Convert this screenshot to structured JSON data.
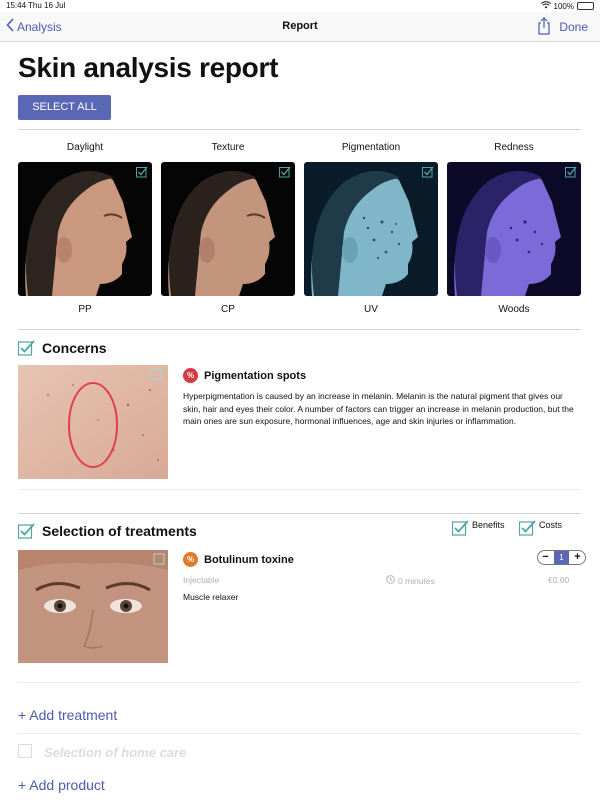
{
  "status_bar": {
    "time": "15:44",
    "date": "Thu 16 Jul",
    "battery": "100%"
  },
  "nav": {
    "back_label": "Analysis",
    "title": "Report",
    "done_label": "Done"
  },
  "page": {
    "title": "Skin analysis report",
    "select_all_label": "SELECT ALL"
  },
  "images": {
    "top_labels": [
      "Daylight",
      "Texture",
      "Pigmentation",
      "Redness"
    ],
    "bottom_labels": [
      "PP",
      "CP",
      "UV",
      "Woods"
    ]
  },
  "concerns": {
    "title": "Concerns",
    "item": {
      "name": "Pigmentation spots",
      "description": "Hyperpigmentation is caused by an increase in melanin. Melanin is the natural pigment that gives our skin, hair and eyes their color. A number of factors can trigger an increase in melanin production, but the main ones are sun exposure, hormonal influences, age and skin injuries or inflammation."
    }
  },
  "treatments": {
    "title": "Selection of treatments",
    "benefits_label": "Benefits",
    "costs_label": "Costs",
    "item": {
      "name": "Botulinum toxine",
      "category": "Injectable",
      "duration": "0 minutes",
      "price": "€0.00",
      "subtitle": "Muscle relaxer",
      "quantity": "1"
    },
    "add_label": "+ Add treatment"
  },
  "home_care": {
    "title": "Selection of home care",
    "add_label": "+ Add product"
  },
  "colors": {
    "accent": "#5a67b5",
    "check": "#4fa3a0",
    "concern_badge": "#d63a43",
    "treatment_badge": "#e07b2e"
  }
}
